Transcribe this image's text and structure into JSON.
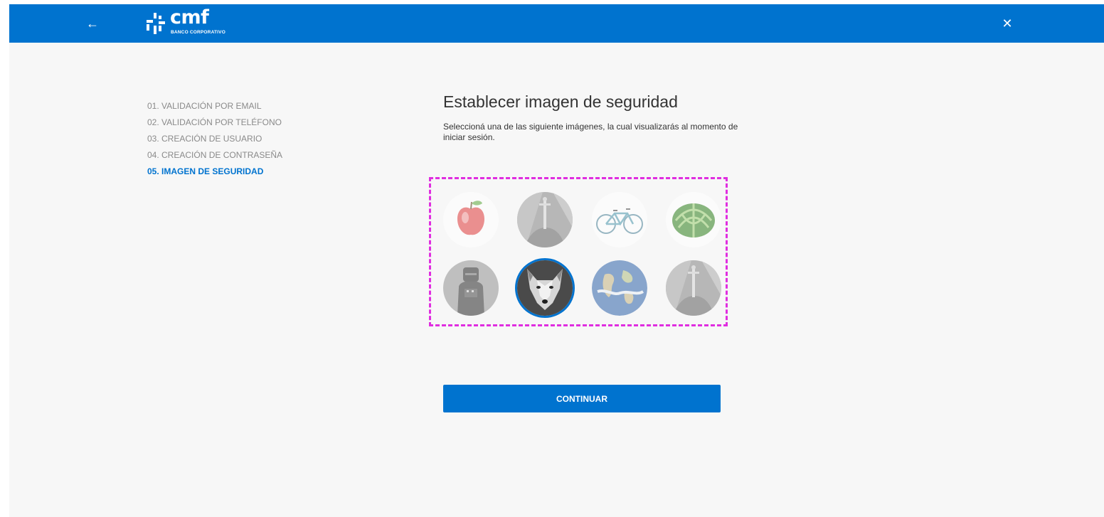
{
  "header": {
    "back_icon": "arrow-left-icon",
    "back_glyph": "←",
    "close_icon": "close-icon",
    "close_glyph": "✕",
    "logo_name": "cmf",
    "logo_sub": "BANCO CORPORATIVO"
  },
  "steps": [
    {
      "label": "01. VALIDACIÓN POR EMAIL",
      "active": false
    },
    {
      "label": "02. VALIDACIÓN POR TELÉFONO",
      "active": false
    },
    {
      "label": "03. CREACIÓN DE USUARIO",
      "active": false
    },
    {
      "label": "04. CREACIÓN DE CONTRASEÑA",
      "active": false
    },
    {
      "label": "05. IMAGEN DE SEGURIDAD",
      "active": true
    }
  ],
  "main": {
    "title": "Establecer imagen de seguridad",
    "subtitle": "Seleccioná una de las siguiente imágenes, la cual visualizarás al momento de iniciar sesión.",
    "continue_label": "CONTINUAR"
  },
  "security_images": [
    {
      "name": "apple",
      "selected": false
    },
    {
      "name": "sword-in-stone",
      "selected": false
    },
    {
      "name": "bicycle",
      "selected": false
    },
    {
      "name": "watermelon",
      "selected": false
    },
    {
      "name": "knight-armor",
      "selected": false
    },
    {
      "name": "wolf",
      "selected": true
    },
    {
      "name": "earth",
      "selected": false
    },
    {
      "name": "sword-in-stone",
      "selected": false
    }
  ],
  "colors": {
    "brand_blue": "#0073cf",
    "selection_outline": "#e02ee0",
    "background": "#f7f7f7"
  }
}
